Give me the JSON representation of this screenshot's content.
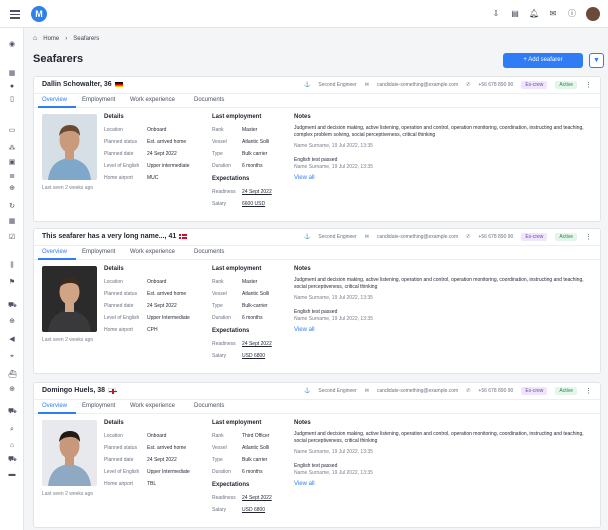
{
  "header": {
    "logo_letter": "M",
    "icons": [
      "download-icon",
      "clipboard-icon",
      "bell-icon",
      "mail-icon",
      "info-icon"
    ]
  },
  "breadcrumb": {
    "home": "Home",
    "sep": "›",
    "current": "Seafarers"
  },
  "page": {
    "title": "Seafarers",
    "add_button": "+ Add seafarer",
    "filter_icon": "filter-icon"
  },
  "tabs": [
    "Overview",
    "Employment",
    "Work experience",
    "Documents"
  ],
  "labels": {
    "details": "Details",
    "last_employment": "Last employment",
    "expectations": "Expectations",
    "notes": "Notes",
    "location": "Location",
    "planned_status": "Planned status",
    "planned_date": "Planned date",
    "english": "Level of English",
    "airport": "Home airport",
    "rank": "Rank",
    "vessel": "Vessel",
    "type": "Type",
    "duration": "Duration",
    "readiness": "Readiness",
    "salary": "Salary",
    "view_all": "View all"
  },
  "cards": [
    {
      "name": "Dallin Schowalter, 36",
      "flag": "de",
      "role": "Second Engineer",
      "email": "candidate-something@example.com",
      "phone": "+56 678 890 90",
      "badge1": "Ex-crew",
      "badge2": "Active",
      "last_seen": "Last seen 2 weeks ago",
      "details": {
        "location": "Onboard",
        "planned_status": "Est. arrived home",
        "planned_date": "24 Sept 2022",
        "english": "Upper intermediate",
        "airport": "MUC"
      },
      "employment": {
        "rank": "Master",
        "vessel": "Atlantic Solli",
        "type": "Bulk carrier",
        "duration": "6 months"
      },
      "expectations": {
        "readiness": "24 Sept 2022",
        "salary": "6600 USD"
      },
      "notes": {
        "text1": "Judgment and decision making, active listening, operation and control, operation monitoring, coordination, instructing and teaching, complex problem solving, social perceptiveness, critical thinking",
        "meta1": "Name Surname, 19 Jul 2022, 13:35",
        "text2": "English test passed",
        "meta2": "Name Surname, 19 Jul 2022, 13:35"
      }
    },
    {
      "name": "This seafarer has a very long name..., 41",
      "flag": "dk",
      "role": "Second Engineer",
      "email": "candidate-something@example.com",
      "phone": "+56 678 890 90",
      "badge1": "Ex-crew",
      "badge2": "Active",
      "last_seen": "Last seen 2 weeks ago",
      "details": {
        "location": "Onboard",
        "planned_status": "Est. arrived home",
        "planned_date": "24 Sept 2022",
        "english": "Upper Intermediate",
        "airport": "CPH"
      },
      "employment": {
        "rank": "Master",
        "vessel": "Atlantic Solli",
        "type": "Bulk-carrier",
        "duration": "6 months"
      },
      "expectations": {
        "readiness": "24 Sept 2022",
        "salary": "USD 6800"
      },
      "notes": {
        "text1": "Judgment and decision making, active listening, operation and control, operation monitoring, coordination, instructing and teaching, social perceptiveness, critical thinking",
        "meta1": "Name Surname, 19 Jul 2022, 13:35",
        "text2": "English test passed",
        "meta2": "Name Surname, 19 Jul 2022, 13:35"
      }
    },
    {
      "name": "Domingo Huels, 38",
      "flag": "en",
      "role": "Second Engineer",
      "email": "candidate-something@example.com",
      "phone": "+56 678 890 90",
      "badge1": "Ex-crew",
      "badge2": "Active",
      "last_seen": "Last seen 2 weeks ago",
      "details": {
        "location": "Onboard",
        "planned_status": "Est. arrived home",
        "planned_date": "24 Sept 2022",
        "english": "Upper Intermediate",
        "airport": "TBL"
      },
      "employment": {
        "rank": "Third Officer",
        "vessel": "Atlantic Solli",
        "type": "Bulk carrier",
        "duration": "6 months"
      },
      "expectations": {
        "readiness": "24 Sept 2022",
        "salary": "USD 6800"
      },
      "notes": {
        "text1": "Judgment and decision making, active listening, operation and control, operation monitoring, coordination, instructing and teaching, social perceptiveness, critical thinking",
        "meta1": "Name Surname, 19 Jul 2022, 13:35",
        "text2": "English test passed",
        "meta2": "Name Surname, 19 Jul 2022, 13:35"
      }
    }
  ]
}
